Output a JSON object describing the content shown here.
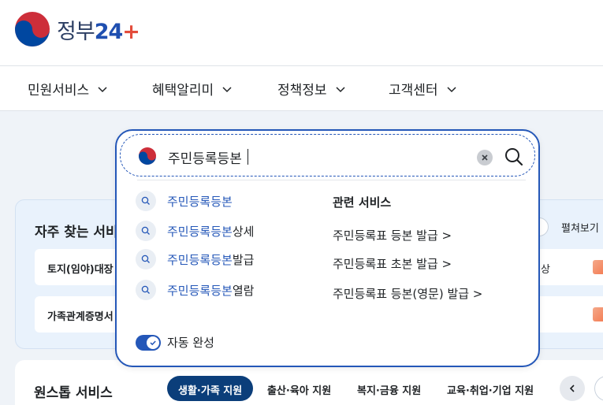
{
  "header": {
    "logo_text": "정부",
    "logo_num": "24",
    "logo_plus": "+"
  },
  "nav": {
    "items": [
      {
        "label": "민원서비스"
      },
      {
        "label": "혜택알리미"
      },
      {
        "label": "정책정보"
      },
      {
        "label": "고객센터"
      }
    ]
  },
  "frequent": {
    "title": "자주 찾는 서비",
    "expand_label": "펼쳐보기",
    "rows": [
      {
        "label": "토지(임야)대장",
        "side": "상"
      },
      {
        "label": "가족관계증명서",
        "side": ""
      }
    ]
  },
  "onestop": {
    "title": "원스톱 서비스",
    "tabs": [
      {
        "label": "생활·가족 지원",
        "active": true
      },
      {
        "label": "출산·육아 지원",
        "active": false
      },
      {
        "label": "복지·금융 지원",
        "active": false
      },
      {
        "label": "교육·취업·기업 지원",
        "active": false
      }
    ]
  },
  "search": {
    "query": "주민등록등본",
    "suggestions": [
      {
        "highlight": "주민등록등본",
        "rest": ""
      },
      {
        "highlight": "주민등록등본",
        "rest": "상세"
      },
      {
        "highlight": "주민등록등본",
        "rest": "발급"
      },
      {
        "highlight": "주민등록등본",
        "rest": "열람"
      }
    ],
    "related_title": "관련 서비스",
    "related": [
      {
        "label": "주민등록표 등본 발급 >"
      },
      {
        "label": "주민등록표 초본 발급 >"
      },
      {
        "label": "주민등록표 등본(영문) 발급 >"
      }
    ],
    "autocomplete_label": "자동 완성",
    "autocomplete_on": true
  },
  "colors": {
    "accent": "#2457b8",
    "nav_dark": "#0b3e7a",
    "card_bg": "#e9f2fc",
    "page_bg": "#eff3f8"
  },
  "icons": [
    "korea-emblem-icon",
    "chevron-down-icon",
    "search-icon",
    "clear-icon",
    "check-icon",
    "chevron-left-icon",
    "document-icon"
  ]
}
